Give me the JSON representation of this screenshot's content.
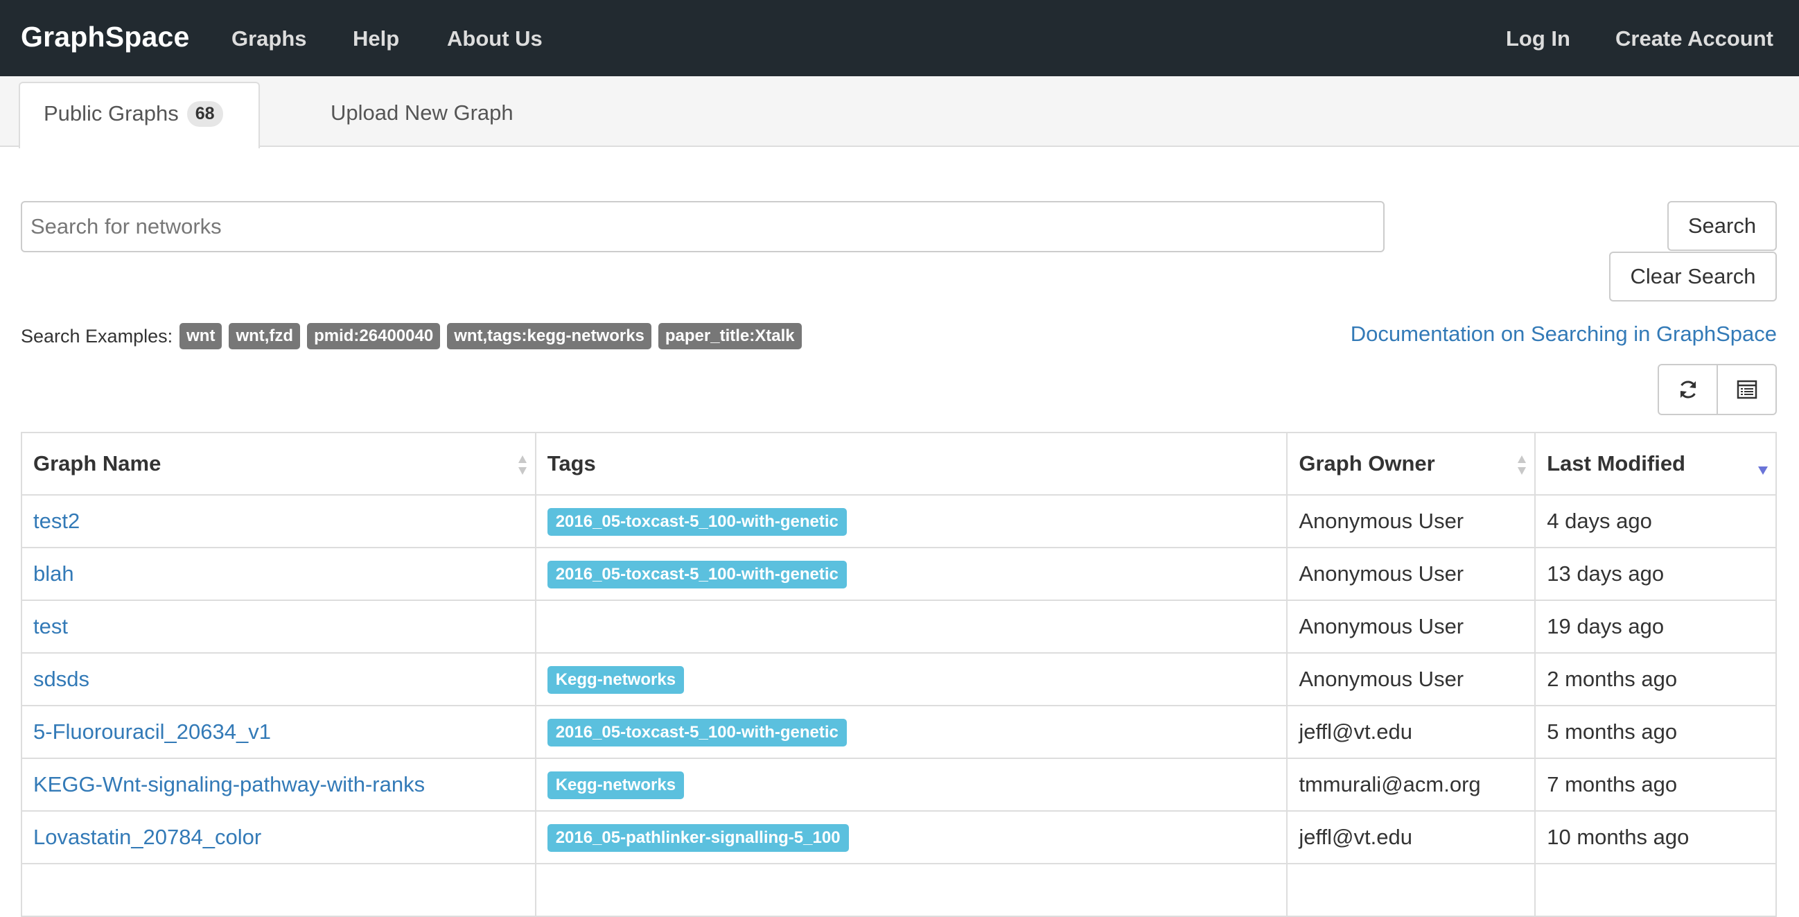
{
  "navbar": {
    "brand": "GraphSpace",
    "links": [
      "Graphs",
      "Help",
      "About Us"
    ],
    "right_links": [
      "Log In",
      "Create Account"
    ]
  },
  "tabs": {
    "public_graphs_label": "Public Graphs",
    "public_graphs_count": "68",
    "upload_label": "Upload New Graph"
  },
  "search": {
    "placeholder": "Search for networks",
    "search_button": "Search",
    "clear_button": "Clear Search",
    "examples_label": "Search Examples:",
    "examples": [
      "wnt",
      "wnt,fzd",
      "pmid:26400040",
      "wnt,tags:kegg-networks",
      "paper_title:Xtalk"
    ],
    "doc_link": "Documentation on Searching in GraphSpace"
  },
  "toolbar": {
    "refresh_icon": "refresh-icon",
    "columns_icon": "list-icon"
  },
  "table": {
    "headers": [
      "Graph Name",
      "Tags",
      "Graph Owner",
      "Last Modified"
    ],
    "rows": [
      {
        "name": "test2",
        "tag": "2016_05-toxcast-5_100-with-genetic",
        "owner": "Anonymous User",
        "modified": "4 days ago"
      },
      {
        "name": "blah",
        "tag": "2016_05-toxcast-5_100-with-genetic",
        "owner": "Anonymous User",
        "modified": "13 days ago"
      },
      {
        "name": "test",
        "tag": "",
        "owner": "Anonymous User",
        "modified": "19 days ago"
      },
      {
        "name": "sdsds",
        "tag": "Kegg-networks",
        "owner": "Anonymous User",
        "modified": "2 months ago"
      },
      {
        "name": "5-Fluorouracil_20634_v1",
        "tag": "2016_05-toxcast-5_100-with-genetic",
        "owner": "jeffl@vt.edu",
        "modified": "5 months ago"
      },
      {
        "name": "KEGG-Wnt-signaling-pathway-with-ranks",
        "tag": "Kegg-networks",
        "owner": "tmmurali@acm.org",
        "modified": "7 months ago"
      },
      {
        "name": "Lovastatin_20784_color",
        "tag": "2016_05-pathlinker-signalling-5_100",
        "owner": "jeffl@vt.edu",
        "modified": "10 months ago"
      },
      {
        "name": "",
        "tag": "",
        "owner": "",
        "modified": ""
      }
    ]
  },
  "colors": {
    "navbar_bg": "#222a30",
    "link": "#337ab7",
    "tag_info": "#5bc0de",
    "tag_default": "#777777"
  }
}
